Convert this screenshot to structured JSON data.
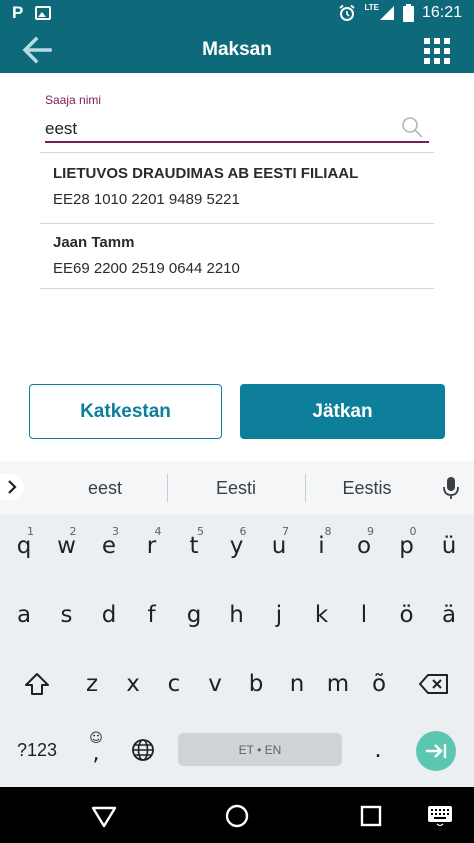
{
  "status_bar": {
    "left_icons": [
      "p-app-icon",
      "image-icon"
    ],
    "app_letter": "P",
    "network": "LTE",
    "time": "16:21"
  },
  "app_bar": {
    "title": "Maksan",
    "back_icon": "arrow-left-icon",
    "menu_icon": "grid-icon",
    "color": "#0e6a7a"
  },
  "recipient_field": {
    "label": "Saaja nimi",
    "value": "eest",
    "accent": "#7a1f56"
  },
  "results": [
    {
      "name": "LIETUVOS DRAUDIMAS AB EESTI FILIAAL",
      "iban": "EE28 1010 2201 9489 5221"
    },
    {
      "name": "Jaan Tamm",
      "iban": "EE69 2200 2519 0644 2210"
    }
  ],
  "buttons": {
    "cancel": "Katkestan",
    "continue": "Jätkan",
    "accent": "#0e7f9a"
  },
  "keyboard": {
    "suggestions": [
      "eest",
      "Eesti",
      "Eestis"
    ],
    "row1": [
      "q",
      "w",
      "e",
      "r",
      "t",
      "y",
      "u",
      "i",
      "o",
      "p",
      "ü"
    ],
    "row1_hints": [
      "1",
      "2",
      "3",
      "4",
      "5",
      "6",
      "7",
      "8",
      "9",
      "0",
      ""
    ],
    "row2": [
      "a",
      "s",
      "d",
      "f",
      "g",
      "h",
      "j",
      "k",
      "l",
      "ö",
      "ä"
    ],
    "row3": [
      "z",
      "x",
      "c",
      "v",
      "b",
      "n",
      "m",
      "õ"
    ],
    "numbers_key": "?123",
    "comma": ",",
    "period": ".",
    "space_label": "ET • EN",
    "enter_color": "#5cc7b1"
  }
}
